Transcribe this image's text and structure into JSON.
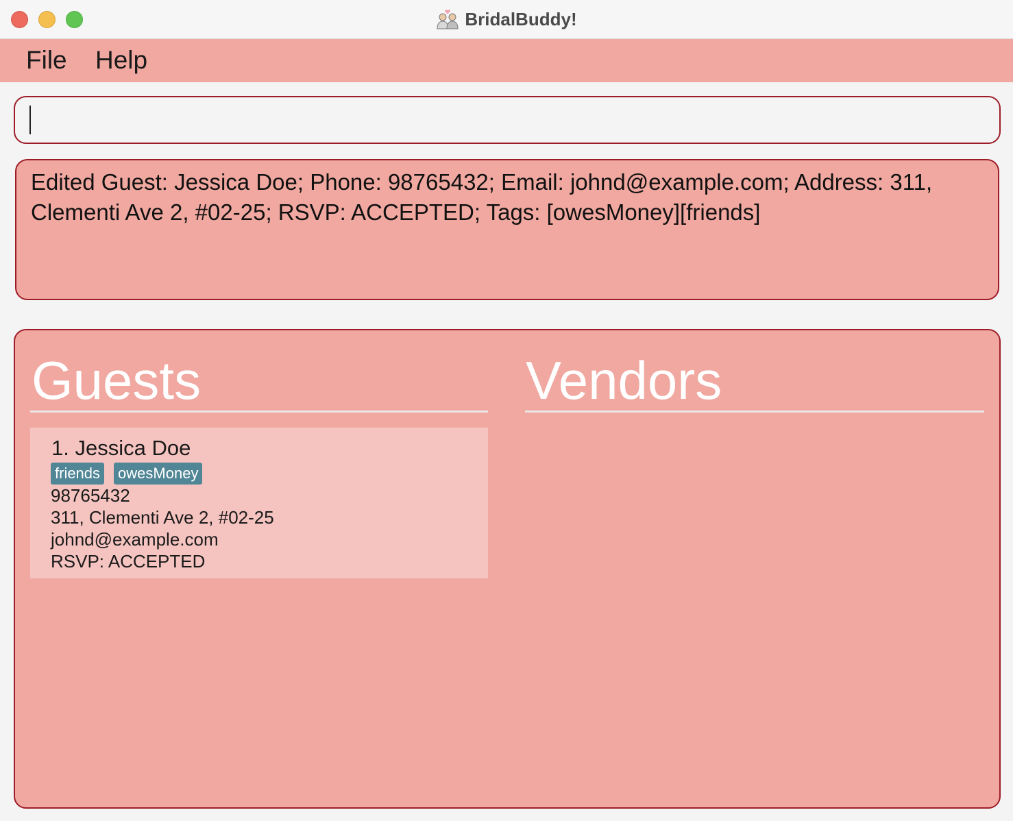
{
  "window": {
    "title": "BridalBuddy!",
    "app_icon": "couple-heart-icon"
  },
  "menu": {
    "file_label": "File",
    "help_label": "Help"
  },
  "command": {
    "value": ""
  },
  "result": {
    "message": "Edited Guest: Jessica Doe; Phone: 98765432; Email: johnd@example.com; Address: 311, Clementi Ave 2, #02-25; RSVP: ACCEPTED; Tags: [owesMoney][friends]"
  },
  "guests": {
    "title": "Guests",
    "items": [
      {
        "index_name": "1. Jessica Doe",
        "tags": [
          "friends",
          "owesMoney"
        ],
        "phone": "98765432",
        "address": "311, Clementi Ave 2, #02-25",
        "email": "johnd@example.com",
        "rsvp": "RSVP: ACCEPTED"
      }
    ]
  },
  "vendors": {
    "title": "Vendors",
    "items": []
  },
  "colors": {
    "panel_background": "#f0a8a0",
    "panel_border": "#9e1c28",
    "card_background": "#f5c4c0",
    "tag_background": "#508695",
    "heading_text": "#ffffff"
  }
}
